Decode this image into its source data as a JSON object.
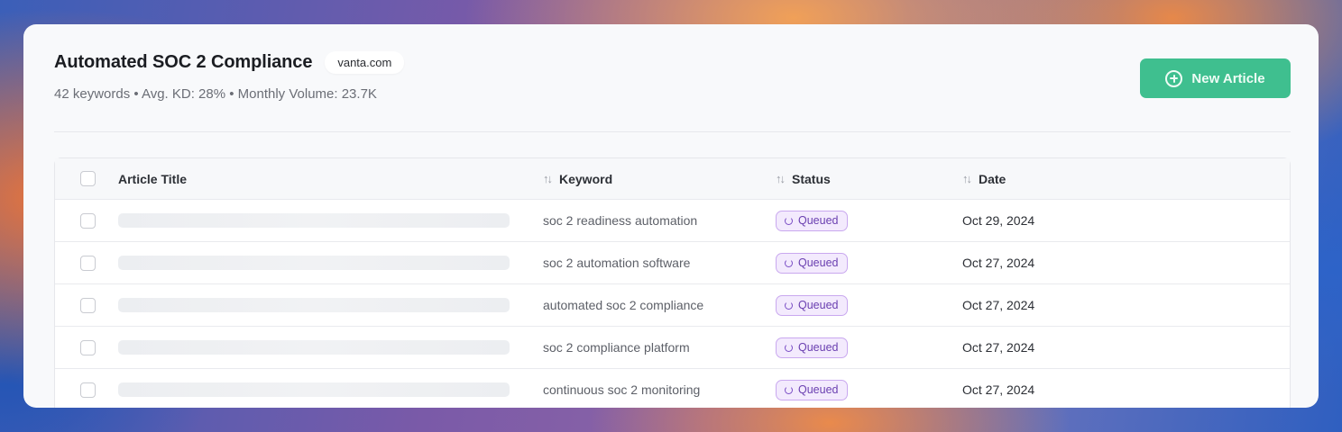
{
  "header": {
    "title": "Automated SOC 2 Compliance",
    "domain": "vanta.com",
    "meta": "42 keywords • Avg. KD: 28% • Monthly Volume: 23.7K",
    "new_button_label": "New Article"
  },
  "table": {
    "columns": {
      "title": "Article Title",
      "keyword": "Keyword",
      "status": "Status",
      "date": "Date"
    },
    "rows": [
      {
        "keyword": "soc 2 readiness automation",
        "status": "Queued",
        "date": "Oct 29, 2024"
      },
      {
        "keyword": "soc 2 automation software",
        "status": "Queued",
        "date": "Oct 27, 2024"
      },
      {
        "keyword": "automated soc 2 compliance",
        "status": "Queued",
        "date": "Oct 27, 2024"
      },
      {
        "keyword": "soc 2 compliance platform",
        "status": "Queued",
        "date": "Oct 27, 2024"
      },
      {
        "keyword": "continuous soc 2 monitoring",
        "status": "Queued",
        "date": "Oct 27, 2024"
      }
    ]
  },
  "icons": {
    "new_button": "plus-circle-icon",
    "sort": "sort-arrows-icon",
    "status": "loading-spinner-icon"
  },
  "colors": {
    "accent_green": "#3fbf8f",
    "badge_purple": "#6a3fb0",
    "badge_bg": "#f3eafd"
  }
}
